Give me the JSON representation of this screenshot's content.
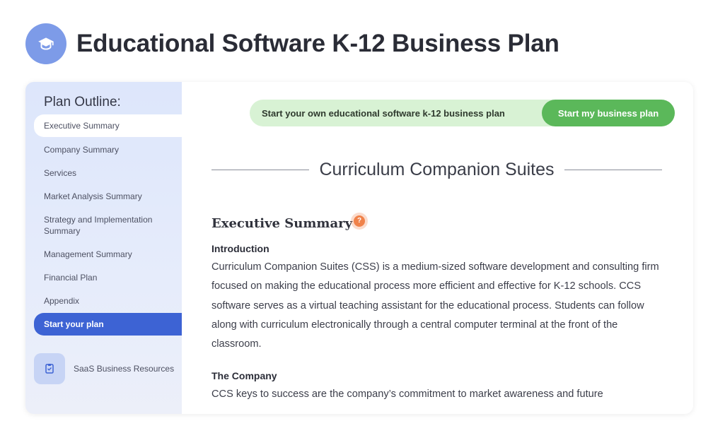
{
  "header": {
    "title": "Educational Software K-12 Business Plan",
    "logo_icon": "graduation-cap-icon"
  },
  "sidebar": {
    "heading": "Plan Outline:",
    "items": [
      {
        "label": "Executive Summary",
        "state": "active"
      },
      {
        "label": "Company Summary"
      },
      {
        "label": "Services"
      },
      {
        "label": "Market Analysis Summary"
      },
      {
        "label": "Strategy and Implementation Summary"
      },
      {
        "label": "Management Summary"
      },
      {
        "label": "Financial Plan"
      },
      {
        "label": "Appendix"
      },
      {
        "label": "Start your plan",
        "state": "highlight"
      }
    ],
    "resource": {
      "label": "SaaS Business Resources",
      "icon": "document-icon"
    }
  },
  "banner": {
    "text": "Start your own educational software k-12 business plan",
    "button": "Start my business plan"
  },
  "plan": {
    "title": "Curriculum Companion Suites",
    "section_heading": "Executive Summary",
    "help_icon": "question-icon",
    "intro_heading": "Introduction",
    "intro_text": "Curriculum Companion Suites (CSS) is a medium-sized software development and consulting firm focused on making the educational process more efficient and effective for K-12 schools. CCS software serves as a virtual teaching assistant for the educational process. Students can follow along with curriculum electronically through a central computer terminal at the front of the classroom.",
    "company_heading": "The Company",
    "company_text": "CCS keys to success are the company’s commitment to market awareness and future"
  },
  "colors": {
    "accent_blue": "#3d63d4",
    "logo_blue": "#7d9be8",
    "banner_green_light": "#d8f2d4",
    "banner_green": "#5bb85a",
    "help_orange": "#f0824a"
  }
}
